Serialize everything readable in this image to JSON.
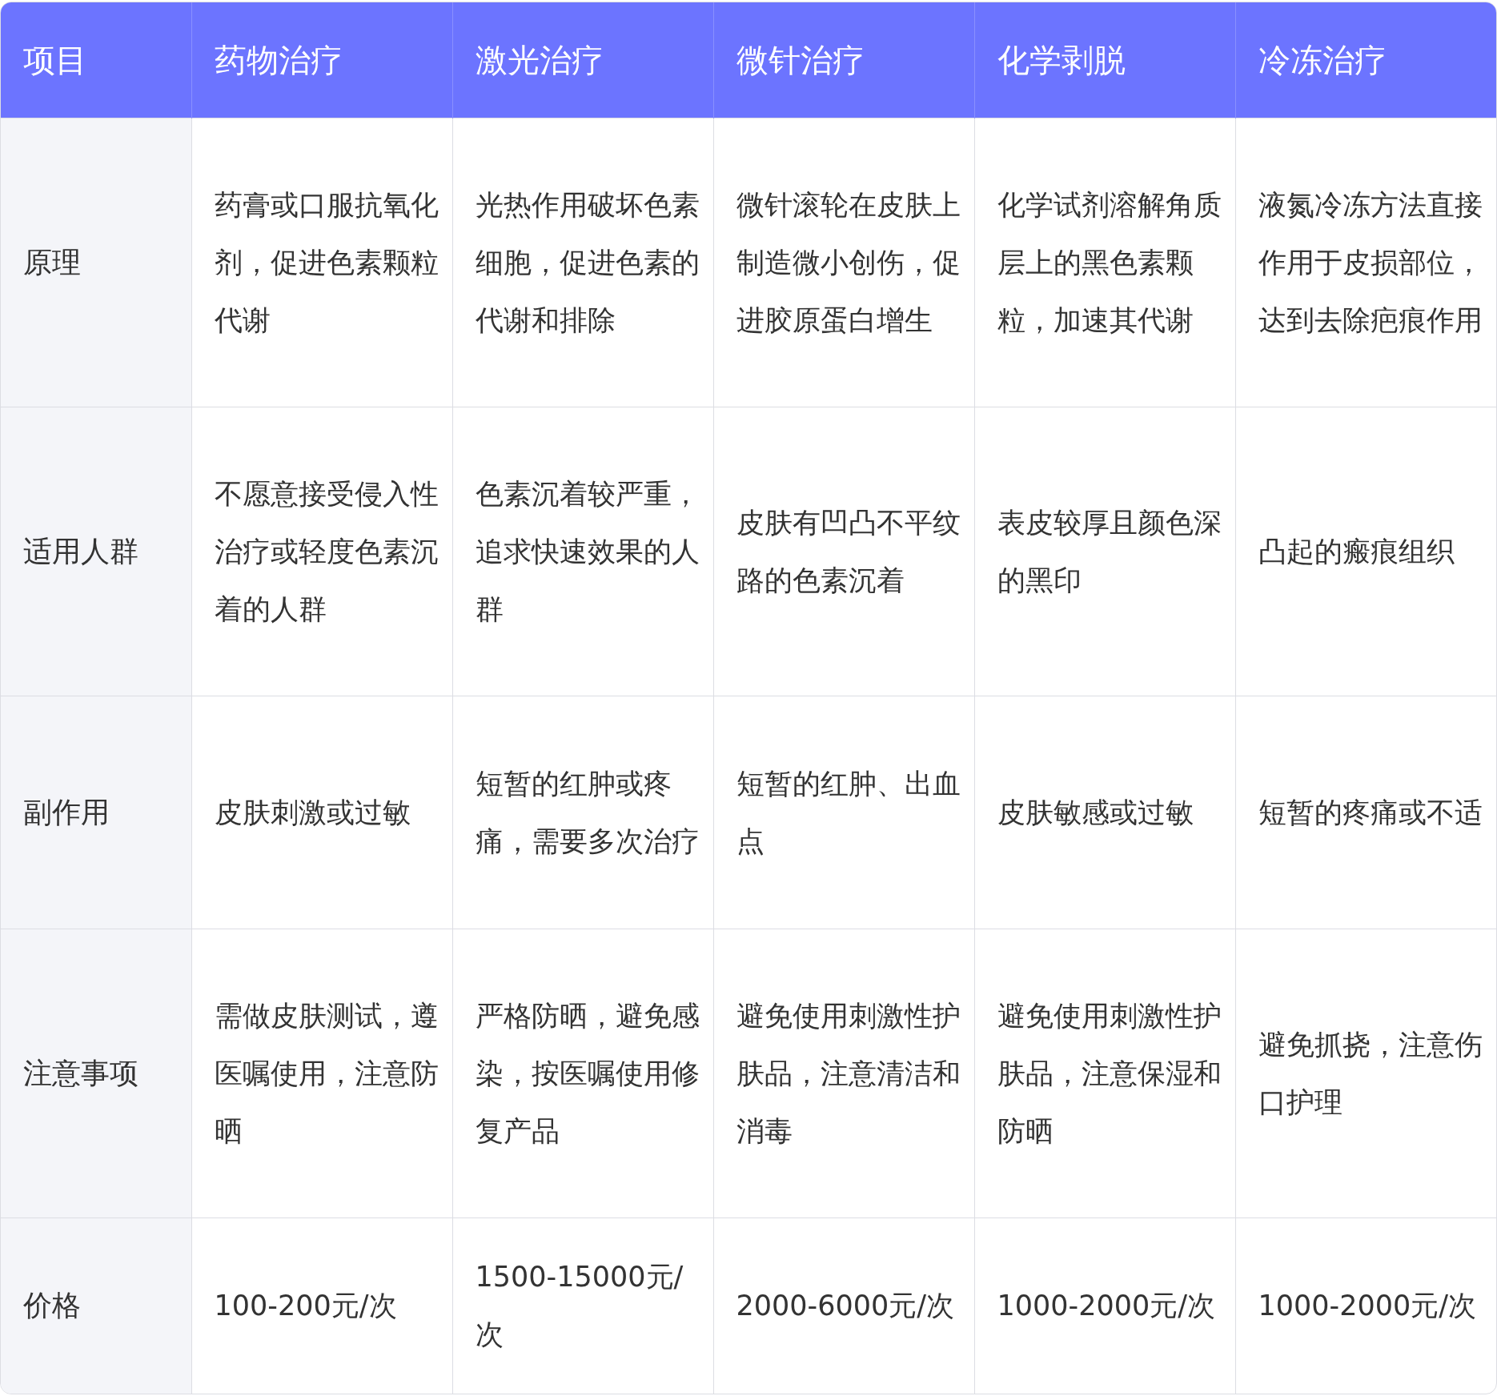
{
  "table": {
    "columns": [
      "项目",
      "药物治疗",
      "激光治疗",
      "微针治疗",
      "化学剥脱",
      "冷冻治疗"
    ],
    "rows": [
      {
        "cells": [
          "原理",
          "药膏或口服抗氧化剂，促进色素颗粒代谢",
          "光热作用破坏色素细胞，促进色素的代谢和排除",
          "微针滚轮在皮肤上制造微小创伤，促进胶原蛋白增生",
          "化学试剂溶解角质层上的黑色素颗粒，加速其代谢",
          "液氮冷冻方法直接作用于皮损部位，达到去除疤痕作用"
        ]
      },
      {
        "cells": [
          "适用人群",
          "不愿意接受侵入性治疗或轻度色素沉着的人群",
          "色素沉着较严重，追求快速效果的人群",
          "皮肤有凹凸不平纹路的色素沉着",
          "表皮较厚且颜色深的黑印",
          "凸起的瘢痕组织"
        ]
      },
      {
        "cells": [
          "副作用",
          "皮肤刺激或过敏",
          "短暂的红肿或疼痛，需要多次治疗",
          "短暂的红肿、出血点",
          "皮肤敏感或过敏",
          "短暂的疼痛或不适"
        ]
      },
      {
        "cells": [
          "注意事项",
          "需做皮肤测试，遵医嘱使用，注意防晒",
          "严格防晒，避免感染，按医嘱使用修复产品",
          "避免使用刺激性护肤品，注意清洁和消毒",
          "避免使用刺激性护肤品，注意保湿和防晒",
          "避免抓挠，注意伤口护理"
        ]
      },
      {
        "cells": [
          "价格",
          "100-200元/次",
          "1500-15000元/次",
          "2000-6000元/次",
          "1000-2000元/次",
          "1000-2000元/次"
        ]
      }
    ]
  }
}
